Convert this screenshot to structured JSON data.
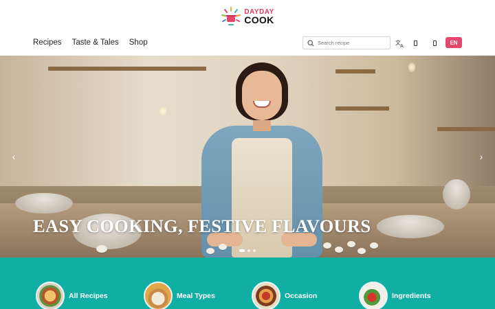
{
  "brand": {
    "line1": "DAYDAY",
    "line2": "COOK"
  },
  "nav": {
    "items": [
      "Recipes",
      "Taste & Tales",
      "Shop"
    ]
  },
  "search": {
    "placeholder": "Search recipe",
    "value": ""
  },
  "header_icons": [
    "translate-icon",
    "notification-icon",
    "user-icon"
  ],
  "language": {
    "current": "EN"
  },
  "hero": {
    "title": "EASY COOKING, FESTIVE FLAVOURS",
    "slides_total": 3,
    "active_slide": 1
  },
  "categories": [
    {
      "label": "All Recipes"
    },
    {
      "label": "Meal Types"
    },
    {
      "label": "Occasion"
    },
    {
      "label": "Ingredients"
    }
  ],
  "colors": {
    "accent_pink": "#e5476a",
    "band_teal": "#11aea4"
  }
}
